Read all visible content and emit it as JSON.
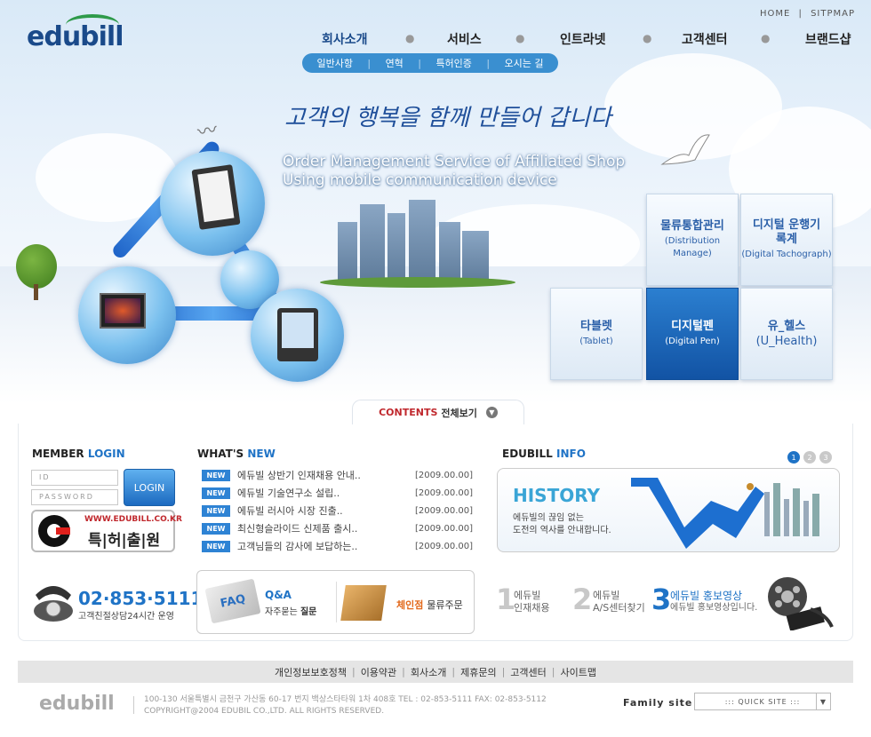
{
  "header": {
    "logo": "edubill",
    "home": "HOME",
    "sitemap": "SITPMAP",
    "sep": "|"
  },
  "gnb": [
    "회사소개",
    "서비스",
    "인트라넷",
    "고객센터",
    "브랜드샵"
  ],
  "subnav": [
    "일반사항",
    "연혁",
    "특허인증",
    "오시는 길"
  ],
  "hero": {
    "slogan": "고객의 행복을 함께 만들어 갑니다",
    "eng1": "Order Management Service of Affiliated Shop",
    "eng2": "Using mobile communication device"
  },
  "tiles": [
    {
      "ko": "물류통합관리",
      "en": "(Distribution Manage)"
    },
    {
      "ko": "디지털 운행기록계",
      "en": "(Digital Tachograph)"
    },
    {
      "ko": "타블렛",
      "en": "(Tablet)"
    },
    {
      "ko": "디지털펜",
      "en": "(Digital Pen)"
    },
    {
      "ko": "유_헬스",
      "en": "(U_Health)"
    }
  ],
  "contents_tab": {
    "a": "CONTENTS",
    "b": "전체보기"
  },
  "member": {
    "t1": "MEMBER",
    "t2": "LOGIN",
    "id": "ID",
    "pw": "PASSWORD",
    "login": "LOGIN",
    "patent_url": "WWW.EDUBILL.CO.KR",
    "patent": "특|허|출|원"
  },
  "phone": {
    "num": "02·853·5111",
    "desc": "고객친절상담24시간 운영"
  },
  "news": {
    "t1": "WHAT'S",
    "t2": "NEW",
    "badge": "NEW",
    "items": [
      {
        "title": "에듀빌 상반기 인재채용 안내..",
        "date": "[2009.00.00]"
      },
      {
        "title": "에듀빌 기술연구소 설립..",
        "date": "[2009.00.00]"
      },
      {
        "title": "에듀빌 러시아 시장 진출..",
        "date": "[2009.00.00]"
      },
      {
        "title": "최신형슬라이드 신제품 출시..",
        "date": "[2009.00.00]"
      },
      {
        "title": "고객님들의 감사에 보답하는..",
        "date": "[2009.00.00]"
      }
    ]
  },
  "qa": {
    "faq": "FAQ",
    "title": "Q&A",
    "sub1": "자주묻는 ",
    "sub2": "질문",
    "shop1": "체인점 ",
    "shop2": "물류주문"
  },
  "info": {
    "t1": "EDUBILL",
    "t2": "INFO",
    "pages": [
      "1",
      "2",
      "3"
    ],
    "history_title": "HISTORY",
    "history_l1": "에듀빌의 끊임 없는",
    "history_l2": "도전의 역사를 안내합니다.",
    "items": [
      {
        "num": "1",
        "l1": "에듀빌",
        "l2": "인재채용"
      },
      {
        "num": "2",
        "l1": "에듀빌",
        "l2": "A/S센터찾기"
      },
      {
        "num": "3",
        "l1": "에듀빌 홍보영상",
        "l2": "에듀빌 홍보영상입니다."
      }
    ]
  },
  "footer": {
    "links": [
      "개인정보보호정책",
      "이용약관",
      "회사소개",
      "제휴문의",
      "고객센터",
      "사이트맵"
    ],
    "logo": "edubill",
    "addr1": "100-130  서울특별시 금천구 가산동 60-17 번지 백상스타타워 1차 408호   TEL : 02-853-5111   FAX: 02-853-5112",
    "addr2": "COPYRIGHT@2004  EDUBIL CO.,LTD.  ALL RIGHTS  RESERVED.",
    "family": "Family site",
    "quick": "::: QUICK SITE :::"
  },
  "colors": {
    "accent": "#1f73c6",
    "brand_green": "#2e9a4a",
    "red": "#c0282d"
  }
}
